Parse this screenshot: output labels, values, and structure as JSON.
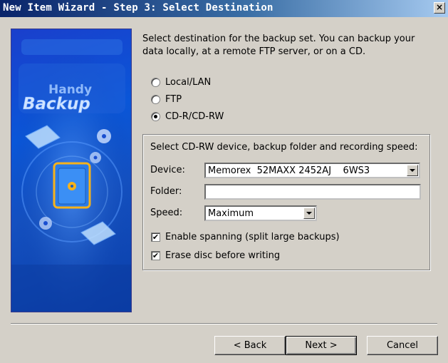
{
  "window": {
    "title": "New Item Wizard - Step 3: Select Destination",
    "close_glyph": "×"
  },
  "side_banner": {
    "logo_line1": "Handy",
    "logo_line2": "Backup"
  },
  "intro_text": "Select destination for the backup set. You can backup your data locally, at a remote FTP server, or on a CD.",
  "destinations": [
    {
      "label": "Local/LAN",
      "selected": false
    },
    {
      "label": "FTP",
      "selected": false
    },
    {
      "label": "CD-R/CD-RW",
      "selected": true
    }
  ],
  "cd_group": {
    "caption": "Select CD-RW device, backup folder and recording speed:",
    "device_label": "Device:",
    "device_value": "Memorex  52MAXX 2452AJ    6WS3",
    "folder_label": "Folder:",
    "folder_value": "",
    "speed_label": "Speed:",
    "speed_value": "Maximum",
    "spanning_label": "Enable spanning (split large backups)",
    "spanning_checked": true,
    "erase_label": "Erase disc before writing",
    "erase_checked": true,
    "check_glyph": "✔"
  },
  "buttons": {
    "back": "< Back",
    "next": "Next >",
    "cancel": "Cancel"
  }
}
